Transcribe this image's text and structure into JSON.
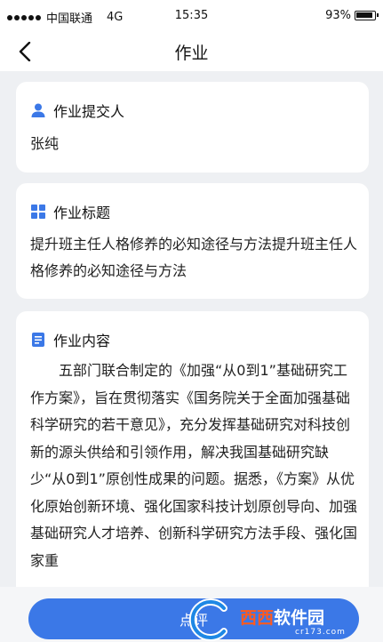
{
  "status_bar": {
    "carrier": "中国联通",
    "network": "4G",
    "time": "15:35",
    "battery": "93%"
  },
  "nav": {
    "title": "作业",
    "back_icon": "chevron-left-icon"
  },
  "submitter": {
    "label": "作业提交人",
    "icon": "person-icon",
    "name": "张纯"
  },
  "homework_title": {
    "label": "作业标题",
    "icon": "grid-icon",
    "value": "提升班主任人格修养的必知途径与方法提升班主任人格修养的必知途径与方法"
  },
  "homework_content": {
    "label": "作业内容",
    "icon": "document-icon",
    "text": "五部门联合制定的《加强“从0到1”基础研究工作方案》，旨在贯彻落实《国务院关于全面加强基础科学研究的若干意见》，充分发挥基础研究对科技创新的源头供给和引领作用，解决我国基础研究缺少“从0到1”原创性成果的问题。据悉，《方案》从优化原始创新环境、强化国家科技计划原创导向、加强基础研究人才培养、创新科学研究方法手段、强化国家重"
  },
  "bottom": {
    "review_label": "点评"
  },
  "watermark": {
    "brand": "西西",
    "name": "软件园",
    "domain": "cr173.com"
  },
  "colors": {
    "accent": "#3b78e7",
    "background": "#eef0f3",
    "card": "#ffffff"
  }
}
